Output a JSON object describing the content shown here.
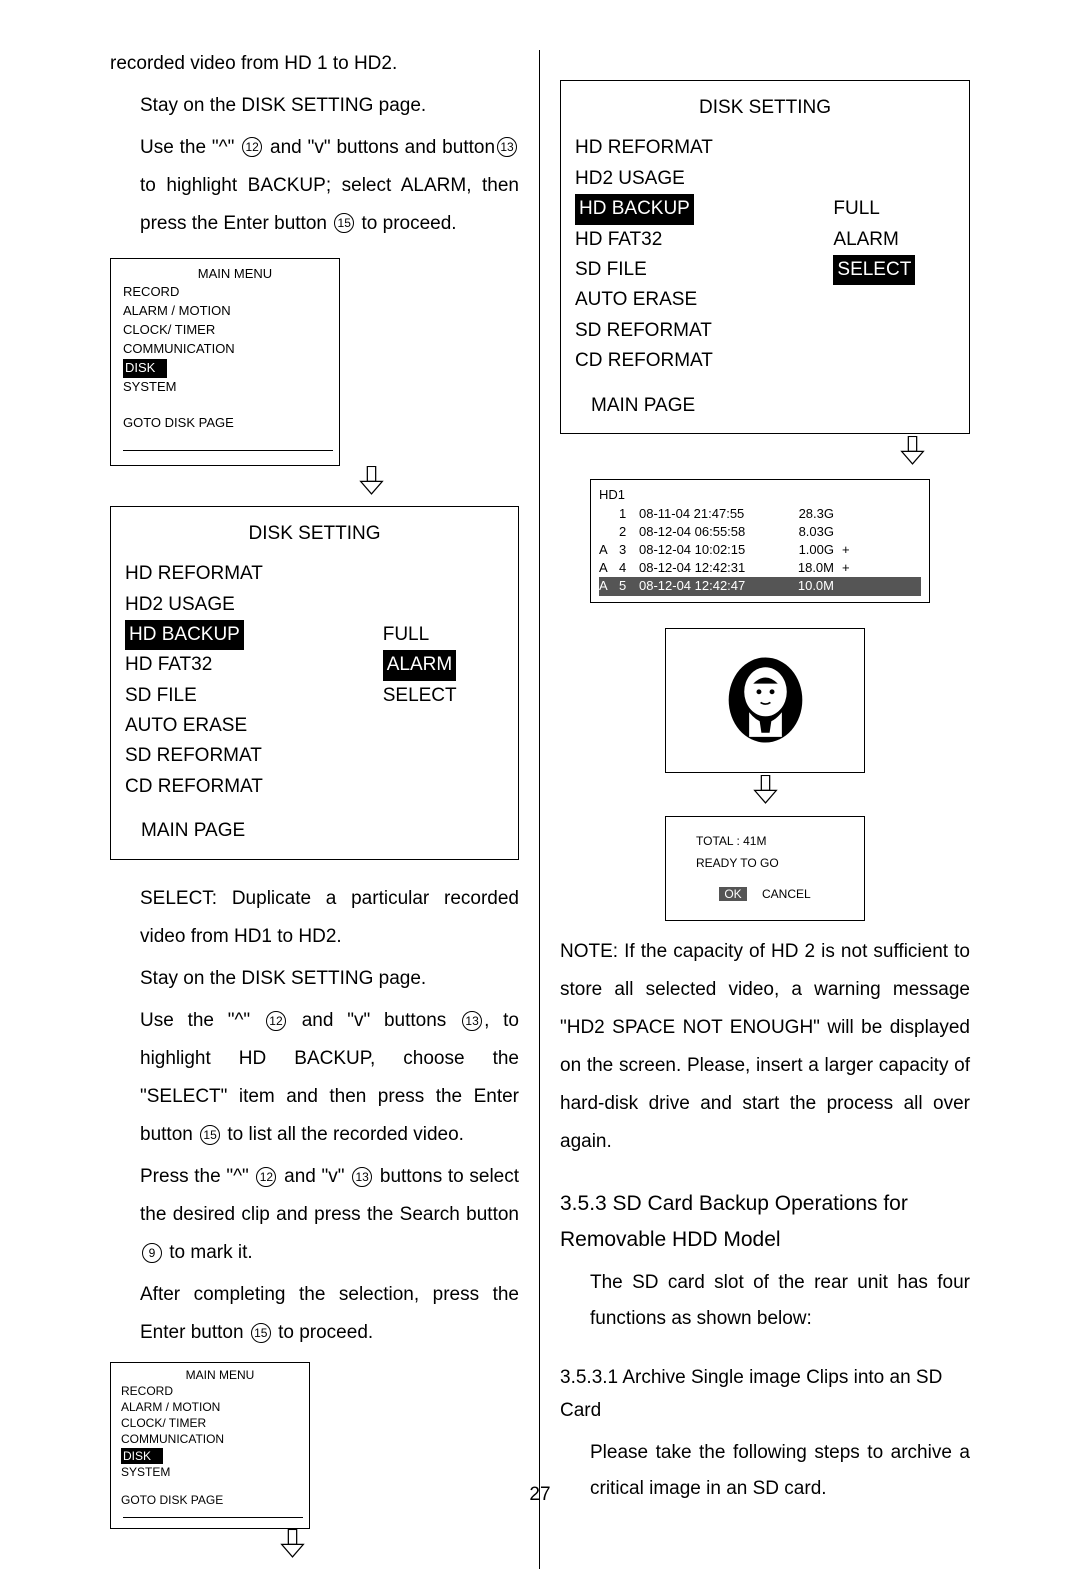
{
  "intro": "recorded video from HD 1 to HD2.",
  "step1": "Stay on the DISK SETTING page.",
  "step2a": "Use the \"^\"",
  "step2b": "and \"v\" buttons and button",
  "step2c": "to highlight BACKUP; select ALARM, then press the Enter button",
  "step2d": "to proceed.",
  "circ9": "9",
  "circ12": "12",
  "circ13": "13",
  "circ15": "15",
  "menu": {
    "title": "MAIN MENU",
    "items": [
      "RECORD",
      "ALARM / MOTION",
      "CLOCK/ TIMER",
      "COMMUNICATION",
      "DISK",
      "SYSTEM"
    ],
    "goto": "GOTO DISK PAGE"
  },
  "diskSetting": {
    "title": "DISK SETTING",
    "items": [
      "HD REFORMAT",
      "HD2 USAGE",
      "HD BACKUP",
      "HD FAT32",
      "SD FILE",
      "AUTO ERASE",
      "SD REFORMAT",
      "CD REFORMAT"
    ],
    "right": [
      "FULL",
      "ALARM",
      "SELECT"
    ],
    "main": "MAIN PAGE"
  },
  "selectText1": "SELECT: Duplicate a particular recorded video from HD1 to HD2.",
  "selectText2": "Stay on the DISK SETTING page.",
  "sel3a": "Use the \"^\"",
  "sel3b": "and \"v\" buttons",
  "sel3c": ", to highlight HD BACKUP, choose the \"SELECT\" item and then press the Enter button",
  "sel3d": "to list all the recorded video.",
  "sel4a": "Press the \"^\"",
  "sel4b": "and \"v\"",
  "sel4c": "buttons to select the desired clip and press the Search button",
  "sel4d": "to mark it.",
  "sel5a": "After completing the selection, press the Enter button",
  "sel5b": "to proceed.",
  "hd1": {
    "title": "HD1",
    "rows": [
      {
        "a": "",
        "n": "1",
        "t": "08-11-04 21:47:55",
        "s": "28.3G",
        "p": ""
      },
      {
        "a": "",
        "n": "2",
        "t": "08-12-04 06:55:58",
        "s": "8.03G",
        "p": ""
      },
      {
        "a": "A",
        "n": "3",
        "t": "08-12-04 10:02:15",
        "s": "1.00G",
        "p": "+"
      },
      {
        "a": "A",
        "n": "4",
        "t": "08-12-04 12:42:31",
        "s": "18.0M",
        "p": "+"
      },
      {
        "a": "A",
        "n": "5",
        "t": "08-12-04 12:42:47",
        "s": "10.0M",
        "p": ""
      }
    ]
  },
  "status": {
    "total": "TOTAL :   41M",
    "ready": "READY  TO  GO",
    "ok": "OK",
    "cancel": "CANCEL"
  },
  "note": "NOTE: If the capacity of HD 2 is not sufficient to store all selected video, a warning message \"HD2 SPACE NOT ENOUGH\" will be displayed on the screen. Please, insert a larger capacity of hard-disk drive and start the process all over again.",
  "h353": "3.5.3 SD Card Backup Operations for Removable HDD Model",
  "p353": "The SD card slot of the rear unit has four functions as shown below:",
  "h3531": "3.5.3.1 Archive Single image Clips into an SD Card",
  "p3531": "Please take the following steps to archive a critical image in an SD card.",
  "pageNum": "27"
}
